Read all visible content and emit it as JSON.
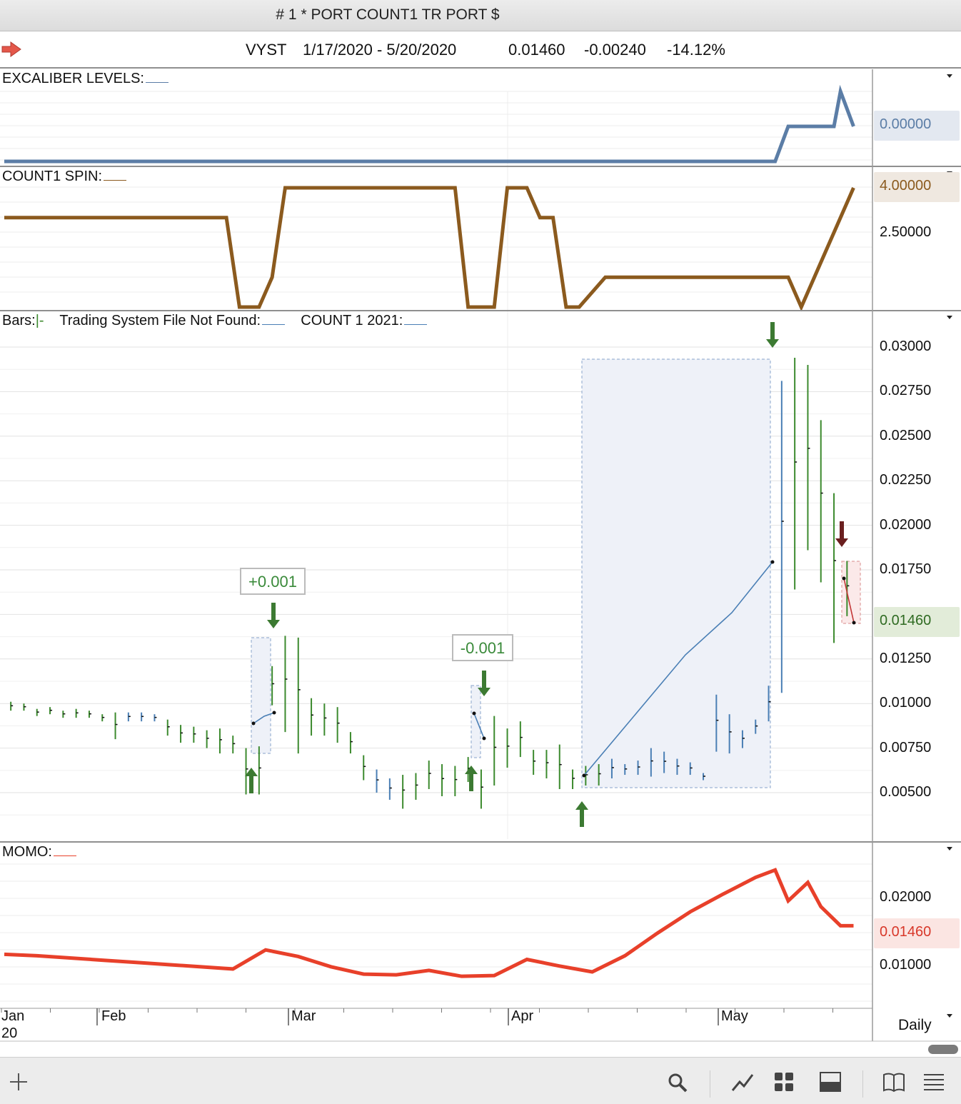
{
  "window": {
    "title": "# 1 * PORT COUNT1 TR PORT  $"
  },
  "header": {
    "symbol": "VYST",
    "date_range": "1/17/2020 - 5/20/2020",
    "last": "0.01460",
    "change": "-0.00240",
    "change_pct": "-14.12%"
  },
  "panels": {
    "excaliber": {
      "label": "EXCALIBER LEVELS:",
      "value_box": "0.00000",
      "color": "#5b7da6"
    },
    "spin": {
      "label": "COUNT1 SPIN:",
      "value_box": "4.00000",
      "tick_250": "2.50000",
      "color": "#8b5a1e"
    },
    "price": {
      "bars_label": "Bars:",
      "bars_marker": "|-",
      "tsf_label": "Trading System File Not Found:",
      "count_label": "COUNT 1 2021:",
      "last_box": "0.01460",
      "ticks": [
        "0.03000",
        "0.02750",
        "0.02500",
        "0.02250",
        "0.02000",
        "0.01750",
        "0.01250",
        "0.01000",
        "0.00750",
        "0.00500"
      ],
      "annotation_1": "+0.001",
      "annotation_2": "-0.001"
    },
    "momo": {
      "label": "MOMO:",
      "tick_high": "0.02000",
      "tick_low": "0.01000",
      "value_box": "0.01460",
      "color": "#e8402a"
    }
  },
  "xaxis": {
    "labels": [
      "Jan",
      "Feb",
      "Mar",
      "Apr",
      "May"
    ],
    "year": "20",
    "period": "Daily"
  },
  "toolbar": {
    "icons": [
      "add-icon",
      "search-icon",
      "line-chart-icon",
      "grid-icon",
      "panel-icon",
      "book-icon",
      "menu-icon"
    ]
  },
  "colors": {
    "up_bar": "#3c8a2e",
    "signal_bar": "#4a7fb5",
    "down_arrow_last": "#6a1f1f",
    "selection_fill": "#eef1f8"
  },
  "chart_data": {
    "type": "bar",
    "title": "VYST",
    "subtitle": "1/17/2020 - 5/20/2020",
    "period": "Daily",
    "price_ylim": [
      0.003,
      0.0316
    ],
    "series": [
      {
        "name": "Bars",
        "x": [
          1,
          3,
          5,
          7,
          9,
          11,
          13,
          15,
          17,
          19,
          21,
          23,
          25,
          27,
          29,
          31,
          33,
          35,
          37,
          39,
          41,
          43,
          45,
          47,
          49,
          51,
          53,
          55,
          57,
          59,
          61,
          63,
          65,
          67,
          69,
          71,
          73,
          75,
          77,
          79,
          81,
          83,
          85,
          87,
          89,
          91,
          93,
          95,
          97,
          99,
          101,
          103,
          105,
          107,
          109,
          111,
          113,
          115,
          117,
          119,
          121,
          123,
          125,
          127,
          129
        ],
        "high": [
          0.0101,
          0.01,
          0.0097,
          0.0098,
          0.0096,
          0.0097,
          0.0096,
          0.0094,
          0.0095,
          0.0095,
          0.0095,
          0.0094,
          0.0091,
          0.0088,
          0.0087,
          0.0085,
          0.0086,
          0.0082,
          0.0075,
          0.0076,
          0.0121,
          0.0138,
          0.0137,
          0.0103,
          0.01,
          0.0098,
          0.0084,
          0.0071,
          0.0063,
          0.0058,
          0.006,
          0.0061,
          0.0068,
          0.0066,
          0.0065,
          0.007,
          0.0063,
          0.0093,
          0.0086,
          0.009,
          0.0074,
          0.0074,
          0.0077,
          0.0063,
          0.0065,
          0.0066,
          0.0069,
          0.0066,
          0.0068,
          0.0075,
          0.0073,
          0.0069,
          0.0067,
          0.0061,
          0.0105,
          0.0094,
          0.0085,
          0.0091,
          0.011,
          0.0281,
          0.0294,
          0.029,
          0.0259,
          0.0218,
          0.018
        ],
        "low": [
          0.0096,
          0.0096,
          0.0093,
          0.0094,
          0.0092,
          0.0092,
          0.0092,
          0.009,
          0.008,
          0.009,
          0.009,
          0.009,
          0.0082,
          0.0078,
          0.0078,
          0.0075,
          0.0072,
          0.0072,
          0.0049,
          0.0049,
          0.0099,
          0.0084,
          0.0072,
          0.0082,
          0.0082,
          0.0078,
          0.0072,
          0.0057,
          0.005,
          0.0046,
          0.0041,
          0.0046,
          0.0052,
          0.0048,
          0.0048,
          0.0056,
          0.0041,
          0.0054,
          0.0064,
          0.007,
          0.006,
          0.0058,
          0.0052,
          0.0052,
          0.0054,
          0.0054,
          0.0058,
          0.006,
          0.006,
          0.0059,
          0.0061,
          0.006,
          0.006,
          0.0057,
          0.0073,
          0.0072,
          0.0075,
          0.0083,
          0.009,
          0.0106,
          0.0164,
          0.0186,
          0.0168,
          0.0134,
          0.0149
        ]
      }
    ],
    "signals": [
      {
        "type": "buy",
        "x": 21,
        "price": 0.0089
      },
      {
        "type": "sell",
        "x": 24,
        "price": 0.0094,
        "result": "+0.001"
      },
      {
        "type": "buy",
        "x": 58,
        "price": 0.0094
      },
      {
        "type": "sell",
        "x": 60,
        "price": 0.008,
        "result": "-0.001"
      },
      {
        "type": "buy",
        "x": 92,
        "price": 0.0059
      },
      {
        "type": "sell",
        "x": 121,
        "price": 0.018
      },
      {
        "type": "sell",
        "x": 130,
        "price": 0.0171
      }
    ],
    "excaliber_line": {
      "x": [
        0,
        118,
        120,
        125,
        127,
        128,
        130
      ],
      "y": [
        0,
        0,
        0.5,
        0.5,
        0.5,
        1.0,
        0.5
      ],
      "ylim": [
        0,
        1
      ]
    },
    "spin_line": {
      "x": [
        0,
        34,
        36,
        39,
        41,
        43,
        69,
        71,
        75,
        77,
        80,
        82,
        84,
        86,
        88,
        92,
        120,
        122,
        130
      ],
      "y": [
        3.0,
        3.0,
        0,
        0,
        1.0,
        4.0,
        4.0,
        0,
        0,
        4.0,
        4.0,
        3.0,
        3.0,
        0,
        0,
        1.0,
        1.0,
        0,
        4.0
      ],
      "ylim": [
        0,
        4.5
      ]
    },
    "momo_line": {
      "x": [
        0,
        5,
        15,
        20,
        35,
        40,
        45,
        50,
        55,
        60,
        65,
        70,
        75,
        80,
        85,
        90,
        95,
        100,
        105,
        110,
        115,
        118,
        120,
        123,
        125,
        128,
        130
      ],
      "y": [
        0.0107,
        0.0105,
        0.0099,
        0.0096,
        0.0087,
        0.0113,
        0.0104,
        0.009,
        0.008,
        0.0079,
        0.0085,
        0.0077,
        0.0078,
        0.01,
        0.0091,
        0.0083,
        0.0105,
        0.0136,
        0.0165,
        0.0189,
        0.0212,
        0.0222,
        0.018,
        0.0205,
        0.0172,
        0.0146,
        0.0146
      ],
      "ylim": [
        0.0045,
        0.0235
      ]
    }
  }
}
